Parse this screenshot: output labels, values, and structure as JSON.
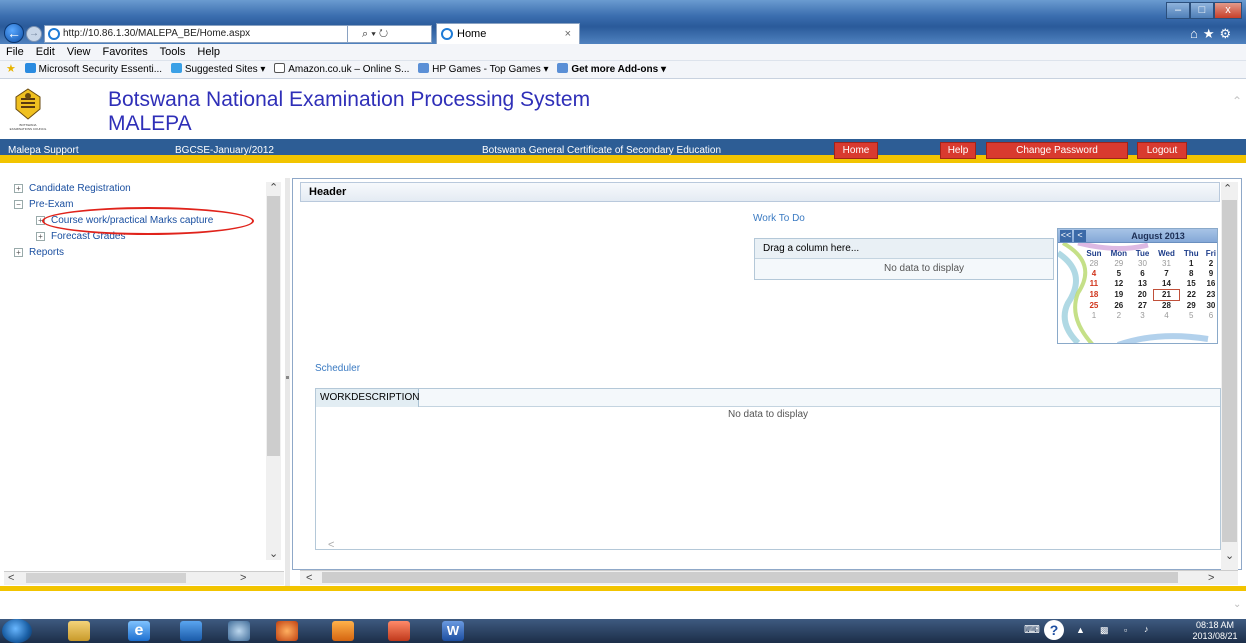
{
  "browser": {
    "address": "http://10.86.1.30/MALEPA_BE/Home.aspx",
    "address_controls": "⌕ ▾ ↻",
    "tab_title": "Home",
    "tab_close": "×",
    "back_icon": "back-arrow-icon",
    "window_controls": {
      "minimize": "–",
      "maximize": "□",
      "close": "x"
    },
    "right_icons": "⌂★⚙"
  },
  "menu": [
    "File",
    "Edit",
    "View",
    "Favorites",
    "Tools",
    "Help"
  ],
  "favorites": [
    {
      "label": "Microsoft Security Essenti...",
      "color": "#2a8be0"
    },
    {
      "label": "Suggested Sites ▾",
      "color": "#3aa0e6"
    },
    {
      "label": "Amazon.co.uk – Online S...",
      "color": "#ffffff"
    },
    {
      "label": "HP Games - Top Games ▾",
      "color": "#5a8fd6"
    },
    {
      "label": "Get more Add-ons ▾",
      "color": "#5a8fd6"
    }
  ],
  "app": {
    "title": "Botswana National Examination Processing System",
    "subtitle": "MALEPA",
    "logo_text": "BOTSWANA EXAMINATIONS COUNCIL"
  },
  "bar": {
    "support": "Malepa Support",
    "session": "BGCSE-January/2012",
    "qualification": "Botswana General Certificate of Secondary Education",
    "home": "Home",
    "help": "Help",
    "change_password": "Change Password",
    "logout": "Logout"
  },
  "tree": {
    "candidate_registration": "Candidate Registration",
    "pre_exam": "Pre-Exam",
    "course_work": "Course work/practical Marks capture",
    "forecast_grades": "Forecast Grades",
    "reports": "Reports"
  },
  "main": {
    "header": "Header",
    "work_to_do": "Work To Do",
    "drag_column": "Drag a column here...",
    "no_data_1": "No data to display",
    "scheduler": "Scheduler",
    "col_workdescription": "WORKDESCRIPTION",
    "no_data_2": "No data to display"
  },
  "calendar": {
    "month": "August 2013",
    "prev_year": "<<",
    "prev_month": "<",
    "days": [
      "Sun",
      "Mon",
      "Tue",
      "Wed",
      "Thu",
      "Fri"
    ],
    "weeks": [
      [
        "28",
        "29",
        "30",
        "31",
        "1",
        "2"
      ],
      [
        "4",
        "5",
        "6",
        "7",
        "8",
        "9"
      ],
      [
        "11",
        "12",
        "13",
        "14",
        "15",
        "16"
      ],
      [
        "18",
        "19",
        "20",
        "21",
        "22",
        "23"
      ],
      [
        "25",
        "26",
        "27",
        "28",
        "29",
        "30"
      ],
      [
        "1",
        "2",
        "3",
        "4",
        "5",
        "6"
      ]
    ],
    "today": "21"
  },
  "taskbar": {
    "time": "08:18 AM",
    "date": "2013/08/21"
  }
}
